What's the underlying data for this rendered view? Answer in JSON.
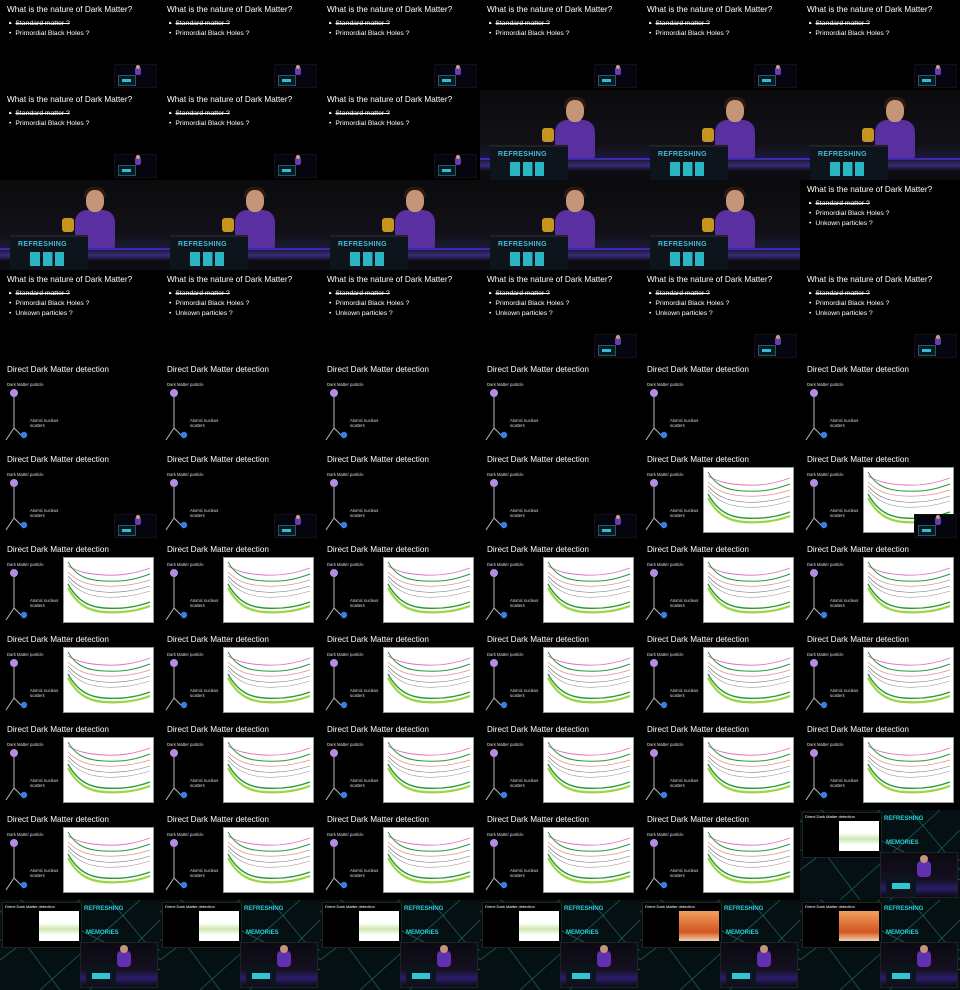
{
  "cols": 6,
  "rows": 11,
  "texts": {
    "title_nature": "What is the nature of Dark Matter?",
    "bullet_standard": "Standard matter ?",
    "bullet_pbh": "Primordial Black Holes ?",
    "bullet_unknown": "Unkown particles ?",
    "title_direct": "Direct Dark Matter detection",
    "dm_particle": "Dark Matter particle",
    "atomic_nucleus": "Atomic nucleus",
    "scatters": "scatters",
    "stage_banner": "REFRESHING",
    "memories": "MEMORIES"
  },
  "frames": [
    "q2",
    "q2",
    "q2",
    "q2",
    "q2",
    "q2",
    "q2",
    "q2",
    "q2",
    "stage",
    "stage",
    "stage",
    "stage",
    "stage",
    "stage",
    "stage",
    "stage",
    "q3",
    "q3",
    "q3",
    "q3",
    "q3",
    "q3",
    "q3",
    "dd",
    "dd",
    "dd",
    "dd",
    "dd",
    "dd",
    "ddm",
    "ddm",
    "dd",
    "ddm",
    "ddp",
    "ddpm",
    "ddp",
    "ddp",
    "ddp",
    "ddp",
    "ddp",
    "ddp",
    "ddp",
    "ddp",
    "ddp",
    "ddp",
    "ddp",
    "ddp",
    "ddp",
    "ddp",
    "ddp",
    "ddp",
    "ddp",
    "ddp",
    "ddp",
    "ddp",
    "ddp",
    "ddp",
    "ddp",
    "mem",
    "mem",
    "mem",
    "mem",
    "mem",
    "memw",
    "memw"
  ],
  "minis": {
    "q2": [
      1,
      1,
      1,
      1,
      1,
      1,
      1,
      1,
      1
    ],
    "q3_mini_indices": [
      21,
      22,
      23
    ]
  },
  "colors": {
    "accent_teal": "#2cc3d0",
    "shirt_purple": "#5a2fa0",
    "curve_green": "#2a9a3a",
    "curve_pink": "#e070c0"
  }
}
